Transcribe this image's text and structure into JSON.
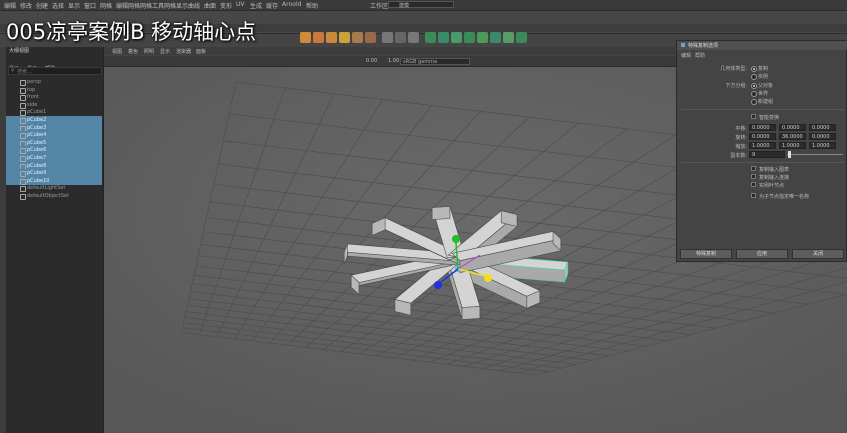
{
  "video_title": "005凉亭案例B  移动轴心点",
  "menubar": {
    "items": [
      "编辑",
      "修改",
      "创建",
      "选择",
      "显示",
      "窗口",
      "网格",
      "编辑网格",
      "网格工具",
      "网格显示",
      "曲线",
      "曲面",
      "变形",
      "UV",
      "生成",
      "缓存",
      "Arnold",
      "帮助"
    ],
    "workspace_label": "工作区:",
    "workspace_value": "建模"
  },
  "outliner": {
    "title": "大纲视图",
    "menu": [
      "显示",
      "显示",
      "帮助"
    ],
    "search_placeholder": "搜索...",
    "rows": [
      {
        "label": "persp",
        "selected": false
      },
      {
        "label": "top",
        "selected": false
      },
      {
        "label": "front",
        "selected": false
      },
      {
        "label": "side",
        "selected": false
      },
      {
        "label": "pCube1",
        "selected": false
      },
      {
        "label": "pCube2",
        "selected": true
      },
      {
        "label": "pCube3",
        "selected": true
      },
      {
        "label": "pCube4",
        "selected": true
      },
      {
        "label": "pCube5",
        "selected": true
      },
      {
        "label": "pCube6",
        "selected": true
      },
      {
        "label": "pCube7",
        "selected": true
      },
      {
        "label": "pCube8",
        "selected": true
      },
      {
        "label": "pCube9",
        "selected": true
      },
      {
        "label": "pCube10",
        "selected": true
      },
      {
        "label": "defaultLightSet",
        "selected": false
      },
      {
        "label": "defaultObjectSet",
        "selected": false
      }
    ]
  },
  "viewport": {
    "menu": [
      "视图",
      "着色",
      "照明",
      "显示",
      "渲染器",
      "面板"
    ],
    "exposure": "0.00",
    "gamma": "1.00",
    "colorspace": "sRGB gamma"
  },
  "panel": {
    "title": "特殊复制选项",
    "menu": [
      "编辑",
      "帮助"
    ],
    "geometry_type_label": "几何体类型:",
    "geometry_type_options": [
      "复制",
      "实例"
    ],
    "group_under_label": "下方分组:",
    "group_under_options": [
      "父对象",
      "世界",
      "新建组"
    ],
    "smart_transform_label": "智能变换",
    "translate_label": "平移:",
    "translate": [
      "0.0000",
      "0.0000",
      "0.0000"
    ],
    "rotate_label": "旋转:",
    "rotate": [
      "0.0000",
      "36.0000",
      "0.0000"
    ],
    "scale_label": "缩放:",
    "scale": [
      "1.0000",
      "1.0000",
      "1.0000"
    ],
    "copies_label": "副本数:",
    "copies": "9",
    "checks": [
      "复制输入图表",
      "复制输入连接",
      "实例叶节点",
      "为子节点指定唯一名称"
    ],
    "buttons": [
      "特殊复制",
      "应用",
      "关闭"
    ]
  },
  "colors": {
    "selection": "#5285a6",
    "viewport_bg": "#636363",
    "cube": "#c8c8c8",
    "manip_green": "#1fbf2a",
    "manip_yellow": "#f2e01a",
    "manip_blue": "#2230e0"
  }
}
